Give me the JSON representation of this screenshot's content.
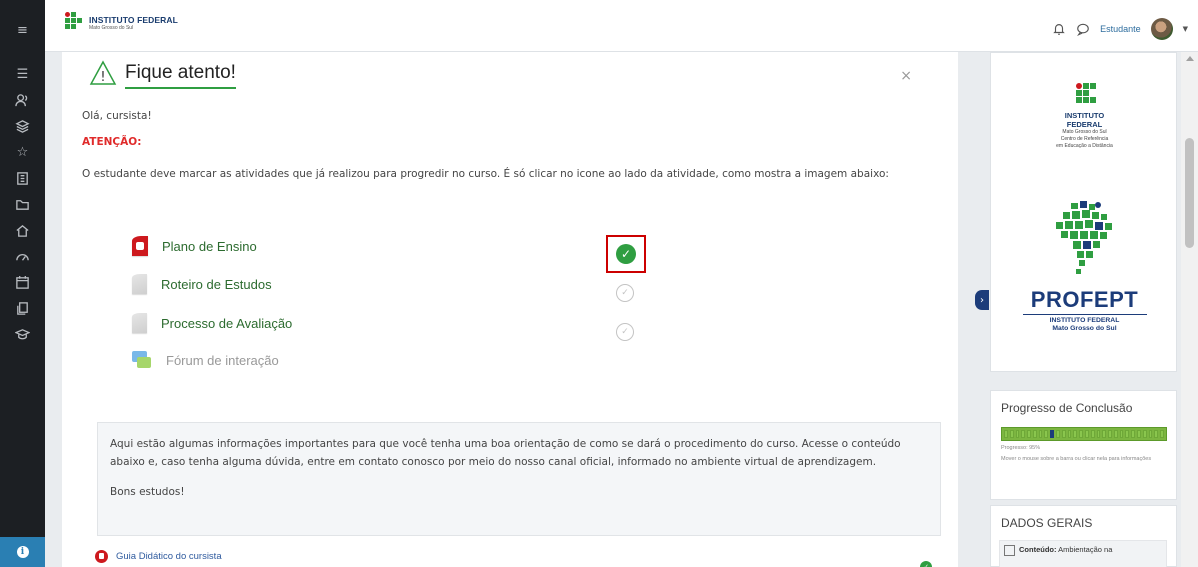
{
  "header": {
    "logo_title": "INSTITUTO FEDERAL",
    "logo_subtitle": "Mato Grosso do Sul",
    "user_name": "Estudante"
  },
  "modal": {
    "title": "Fique atento!",
    "close": "×",
    "greeting": "Olá, cursista!",
    "attention": "ATENÇÃO:",
    "description": "O estudante deve marcar as atividades que já realizou para progredir no curso. É só clicar no icone ao lado da atividade, como mostra a imagem abaixo:",
    "activities": [
      {
        "label": "Plano de Ensino",
        "icon": "pdf-icon",
        "status": "done"
      },
      {
        "label": "Roteiro de Estudos",
        "icon": "document-icon",
        "status": "pending"
      },
      {
        "label": "Processo de Avaliação",
        "icon": "document-icon",
        "status": "pending"
      },
      {
        "label": "Fórum de interação",
        "icon": "forum-icon",
        "status": "none"
      }
    ]
  },
  "info": {
    "text": "Aqui estão algumas informações importantes para que você tenha uma boa orientação de como se dará o procedimento do curso. Acesse o conteúdo abaixo e, caso tenha alguma dúvida, entre em contato conosco por meio do nosso canal oficial, informado no ambiente virtual de aprendizagem.",
    "closing": "Bons estudos!"
  },
  "guide": {
    "label": "Guia Didático do cursista"
  },
  "drawer": {
    "ifms_title1": "INSTITUTO",
    "ifms_title2": "FEDERAL",
    "ifms_sub1": "Mato Grosso do Sul",
    "ifms_sub2": "Centro de Referência",
    "ifms_sub3": "em Educação a Distância",
    "profept": "PROFEPT",
    "profept_sub1": "INSTITUTO FEDERAL",
    "profept_sub2": "Mato Grosso do Sul",
    "progress_title": "Progresso de Conclusão",
    "progress_fraction": 0.95,
    "progress_text": "Progresso: 95%",
    "progress_hint": "Mover o mouse sobre a barra ou clicar nela para informações",
    "dados_title": "DADOS GERAIS",
    "dados_label": "Conteúdo:",
    "dados_value": "Ambientação na"
  },
  "colors": {
    "accent_green": "#2f9e41",
    "ifms_red": "#cd191e",
    "profept_blue": "#1c3c7a",
    "attention_red": "#e02b2b"
  }
}
